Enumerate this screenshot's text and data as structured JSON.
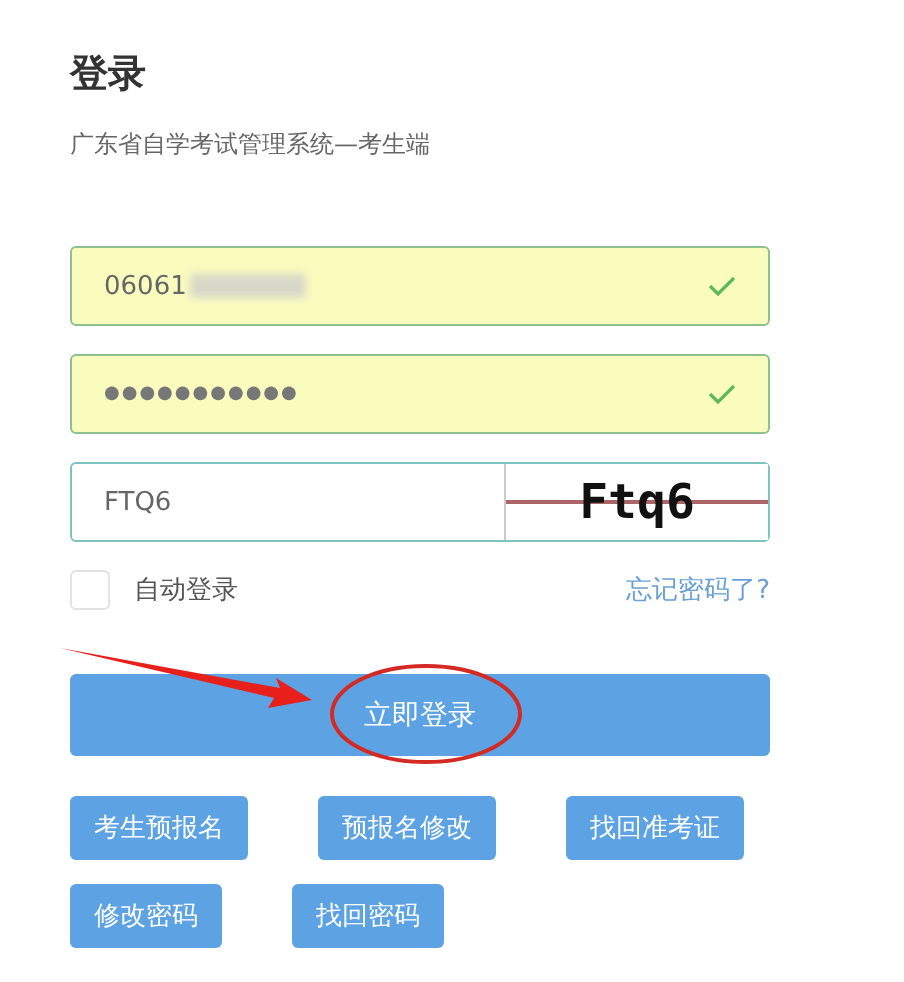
{
  "title": "登录",
  "subtitle": "广东省自学考试管理系统—考生端",
  "fields": [
    {
      "kind": "text",
      "value": "06061",
      "redacted": true,
      "valid": true
    },
    {
      "kind": "password",
      "value": "●●●●●●●●●●●",
      "redacted": false,
      "valid": true
    },
    {
      "kind": "captcha",
      "value": "FTQ6",
      "captcha": "Ftq6",
      "redacted": false,
      "valid": false
    }
  ],
  "remember": {
    "label": "自动登录",
    "checked": false
  },
  "forgot_link": "忘记密码了?",
  "login_button": "立即登录",
  "action_buttons": [
    [
      "考生预报名",
      "预报名修改",
      "找回准考证"
    ],
    [
      "修改密码",
      "找回密码"
    ]
  ]
}
